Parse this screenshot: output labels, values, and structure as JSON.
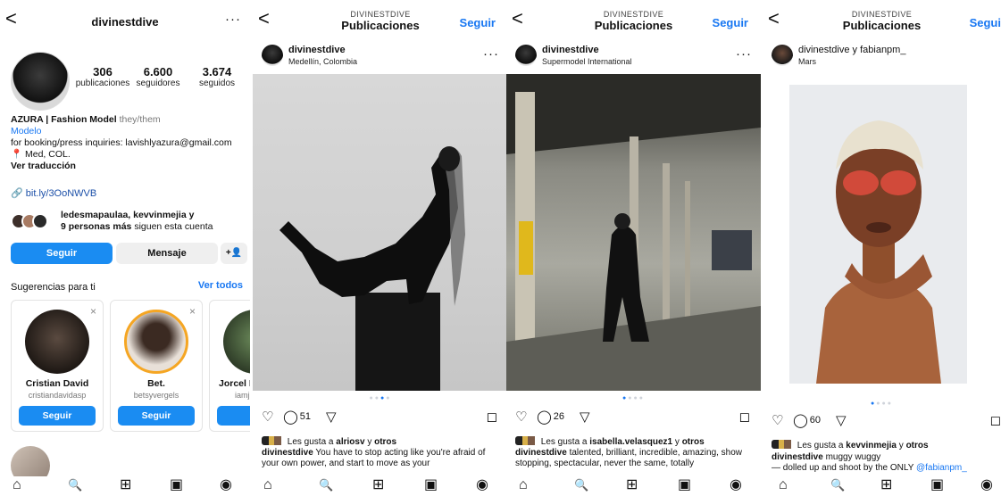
{
  "profile": {
    "username": "divinestdive",
    "more_label": "···",
    "back_label": "<",
    "stats": [
      {
        "value": "306",
        "label": "publicaciones"
      },
      {
        "value": "6.600",
        "label": "seguidores"
      },
      {
        "value": "3.674",
        "label": "seguidos"
      }
    ],
    "bio_name": "AZURA | Fashion Model",
    "bio_pronouns": "they/them",
    "bio_category": "Modelo",
    "bio_line1": "for booking/press inquiries: lavishlyazura@gmail.com",
    "bio_line2": "📍 Med, COL.",
    "bio_translate": "Ver traducción",
    "link_label": "bit.ly/3OoNWVB",
    "mutuals_line1": "ledesmapaulaa, kevvinmejia y",
    "mutuals_strong": "9 personas más",
    "mutuals_rest": "siguen esta cuenta",
    "follow_button": "Seguir",
    "message_button": "Mensaje",
    "add_user_glyph": "+👤",
    "suggestions_title": "Sugerencias para ti",
    "see_all": "Ver todos",
    "suggestions": [
      {
        "name": "Cristian David",
        "handle": "cristiandavidasp",
        "button": "Seguir",
        "close": "×"
      },
      {
        "name": "Bet.",
        "handle": "betsyvergels",
        "button": "Seguir",
        "close": "×"
      },
      {
        "name": "Jorcel H",
        "handle": "iamj",
        "button": "Se",
        "close": ""
      }
    ]
  },
  "posts": [
    {
      "header_sub": "DIVINESTDIVE",
      "header_title": "Publicaciones",
      "follow": "Seguir",
      "user": "divinestdive",
      "location": "Medellín, Colombia",
      "comments": "51",
      "likes_prefix": "Les gusta a",
      "likes_user": "alriosv",
      "likes_and": "y",
      "likes_others": "otros",
      "caption_user": "divinestdive",
      "caption_text": "You have to stop acting like you're afraid of your own power, and start to move as your"
    },
    {
      "header_sub": "DIVINESTDIVE",
      "header_title": "Publicaciones",
      "follow": "Seguir",
      "user": "divinestdive",
      "location": "Supermodel International",
      "comments": "26",
      "likes_prefix": "Les gusta a",
      "likes_user": "isabella.velasquez1",
      "likes_and": "y",
      "likes_others": "otros",
      "caption_user": "divinestdive",
      "caption_text": "talented, brilliant, incredible, amazing, show stopping, spectacular, never the same, totally"
    },
    {
      "header_sub": "DIVINESTDIVE",
      "header_title": "Publicaciones",
      "follow": "Segui",
      "user": "divinestdive y fabianpm_",
      "location": "Mars",
      "comments": "60",
      "likes_prefix": "Les gusta a",
      "likes_user": "kevvinmejia",
      "likes_and": "y",
      "likes_others": "otros",
      "caption_user": "divinestdive",
      "caption_text": "muggy wuggy",
      "caption_line2": "— dolled up and shoot by the ONLY",
      "caption_mention": "@fabianpm_"
    }
  ],
  "icons": {
    "heart": "♡",
    "comment": "◯",
    "share": "▽",
    "save": "◻",
    "home": "⌂",
    "search": "🔍",
    "create": "⊞",
    "reels": "▣",
    "profile": "◉"
  },
  "colors": {
    "accent": "#1877f2",
    "button": "#1a8cf2"
  }
}
